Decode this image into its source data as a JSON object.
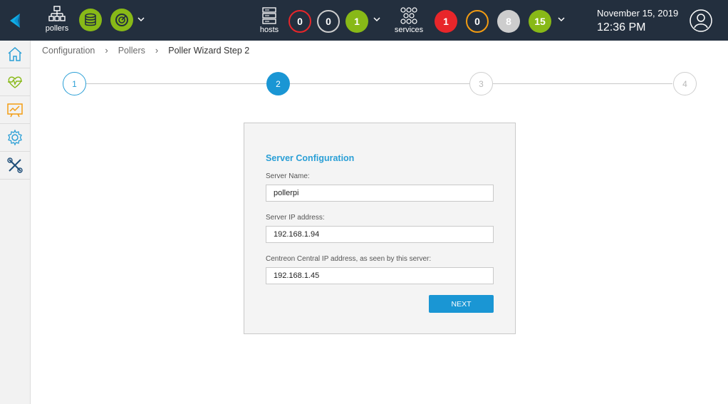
{
  "header": {
    "pollers_label": "pollers",
    "hosts_label": "hosts",
    "services_label": "services",
    "host_counts": [
      "0",
      "0",
      "1"
    ],
    "service_counts": [
      "1",
      "0",
      "8",
      "15"
    ],
    "date": "November 15, 2019",
    "time": "12:36 PM",
    "colors": {
      "bar": "#232f3e",
      "green": "#88b917",
      "red": "#e8262a",
      "orange": "#f39c12",
      "grey": "#cdcdcd"
    }
  },
  "sidebar": {
    "icons": [
      "home-icon",
      "monitoring-icon",
      "reporting-icon",
      "configuration-icon",
      "administration-icon"
    ]
  },
  "breadcrumb": [
    "Configuration",
    "Pollers",
    "Poller Wizard Step 2"
  ],
  "stepper": {
    "steps": [
      "1",
      "2",
      "3",
      "4"
    ],
    "current": 2
  },
  "form": {
    "title": "Server Configuration",
    "server_name_label": "Server Name:",
    "server_name_value": "pollerpi",
    "server_ip_label": "Server IP address:",
    "server_ip_value": "192.168.1.94",
    "central_ip_label": "Centreon Central IP address, as seen by this server:",
    "central_ip_value": "192.168.1.45",
    "next_label": "NEXT"
  }
}
